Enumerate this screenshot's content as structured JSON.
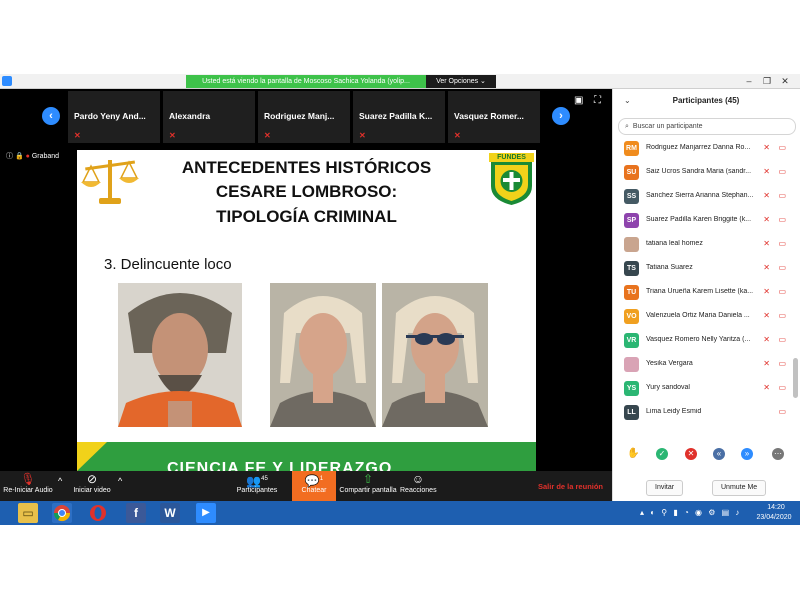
{
  "titlebar": {
    "share_banner": "Usted está viendo la pantalla de Moscoso Sachica Yolanda (yolip...",
    "view_options": "Ver Opciones ⌄"
  },
  "thumbnails": [
    {
      "name": "Pardo Yeny And..."
    },
    {
      "name": "Alexandra"
    },
    {
      "name": "Rodriguez  Manj..."
    },
    {
      "name": "Suarez Padilla K..."
    },
    {
      "name": "Vasquez Romer..."
    }
  ],
  "recording": {
    "label": "Graband"
  },
  "slide": {
    "title_line1": "ANTECEDENTES HISTÓRICOS",
    "title_line2": "CESARE LOMBROSO:",
    "title_line3": "TIPOLOGÍA CRIMINAL",
    "subtitle": "3. Delincuente loco",
    "logo_text": "FUNDES",
    "band_text": "CIENCIA FE Y LIDERAZGO"
  },
  "toolbar": {
    "audio": "Re-Iniciar Audio",
    "video": "Iniciar video",
    "participants": "Participantes",
    "participants_count": "45",
    "chat": "Chatear",
    "chat_badge": "1",
    "share": "Compartir pantalla",
    "reactions": "Reacciones",
    "end": "Salir de la reunión"
  },
  "panel": {
    "title": "Participantes (45)",
    "search_placeholder": "Buscar un participante",
    "participants": [
      {
        "initials": "RM",
        "name": "Rodriguez Manjarrez Danna Ro...",
        "color": "#f08c1e"
      },
      {
        "initials": "SU",
        "name": "Saiz Ucros Sandra Maria (sandr...",
        "color": "#e8731e"
      },
      {
        "initials": "SS",
        "name": "Sanchez Sierra Arianna Stephan...",
        "color": "#455a64"
      },
      {
        "initials": "SP",
        "name": "Suarez Padilla Karen Briggite (k...",
        "color": "#8e44ad"
      },
      {
        "initials": "",
        "name": "tatiana leal homez",
        "color": "#c9a58f"
      },
      {
        "initials": "TS",
        "name": "Tatiana Suarez",
        "color": "#37474f"
      },
      {
        "initials": "TU",
        "name": "Triana Urueña Karem Lisette (ka...",
        "color": "#e8731e"
      },
      {
        "initials": "VO",
        "name": "Valenzuela Ortiz Maria Daniela ...",
        "color": "#f0a020"
      },
      {
        "initials": "VR",
        "name": "Vasquez Romero Nelly Yaritza (...",
        "color": "#2bb673"
      },
      {
        "initials": "",
        "name": "Yesika Vergara",
        "color": "#d9a3b5"
      },
      {
        "initials": "YS",
        "name": "Yury sandoval",
        "color": "#2bb673"
      },
      {
        "initials": "LL",
        "name": "Lima Leidy Esmid",
        "color": "#37474f"
      }
    ],
    "invite": "Invitar",
    "unmute": "Unmute Me"
  },
  "taskbar": {
    "time": "14:20",
    "date": "23/04/2020"
  },
  "colors": {
    "accent": "#2e8cff",
    "banner_green": "#3ec24a",
    "chat_orange": "#f26d21",
    "leave_red": "#e0312b",
    "taskbar": "#1e5fb0"
  }
}
